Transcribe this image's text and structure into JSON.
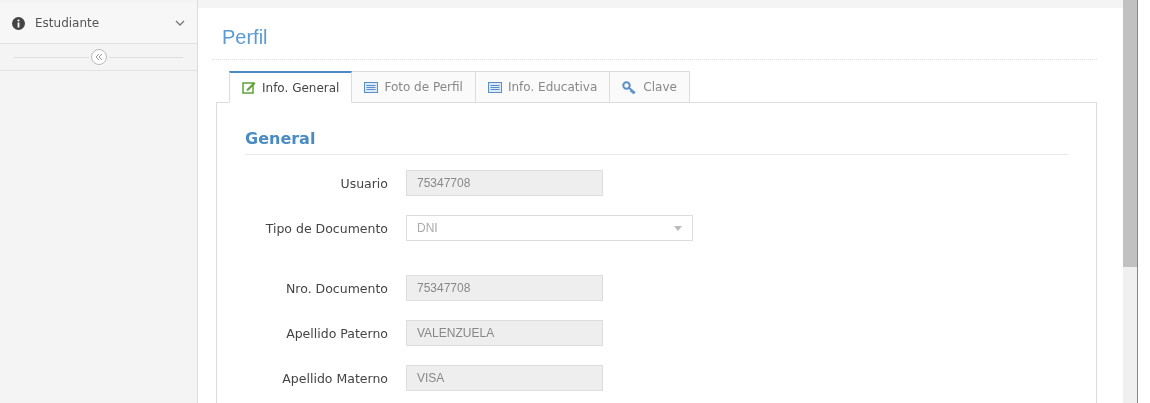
{
  "sidebar": {
    "items": [
      {
        "label": "Estudiante",
        "expanded": false
      }
    ]
  },
  "page": {
    "title": "Perfil"
  },
  "tabs": [
    {
      "label": "Info. General",
      "kind": "edit",
      "selected": true
    },
    {
      "label": "Foto de Perfil",
      "kind": "list",
      "selected": false
    },
    {
      "label": "Info. Educativa",
      "kind": "list",
      "selected": false
    },
    {
      "label": "Clave",
      "kind": "key",
      "selected": false
    }
  ],
  "section": {
    "title": "General"
  },
  "fields": [
    {
      "label": "Usuario",
      "kind": "text",
      "value": "75347708",
      "disabled": true
    },
    {
      "label": "Tipo de Documento",
      "kind": "select",
      "value": "DNI",
      "disabled": true
    },
    {
      "label": "Nro. Documento",
      "kind": "text",
      "value": "75347708",
      "disabled": true
    },
    {
      "label": "Apellido Paterno",
      "kind": "text",
      "value": "VALENZUELA",
      "disabled": true
    },
    {
      "label": "Apellido Materno",
      "kind": "text",
      "value": "VISA",
      "disabled": true
    }
  ]
}
